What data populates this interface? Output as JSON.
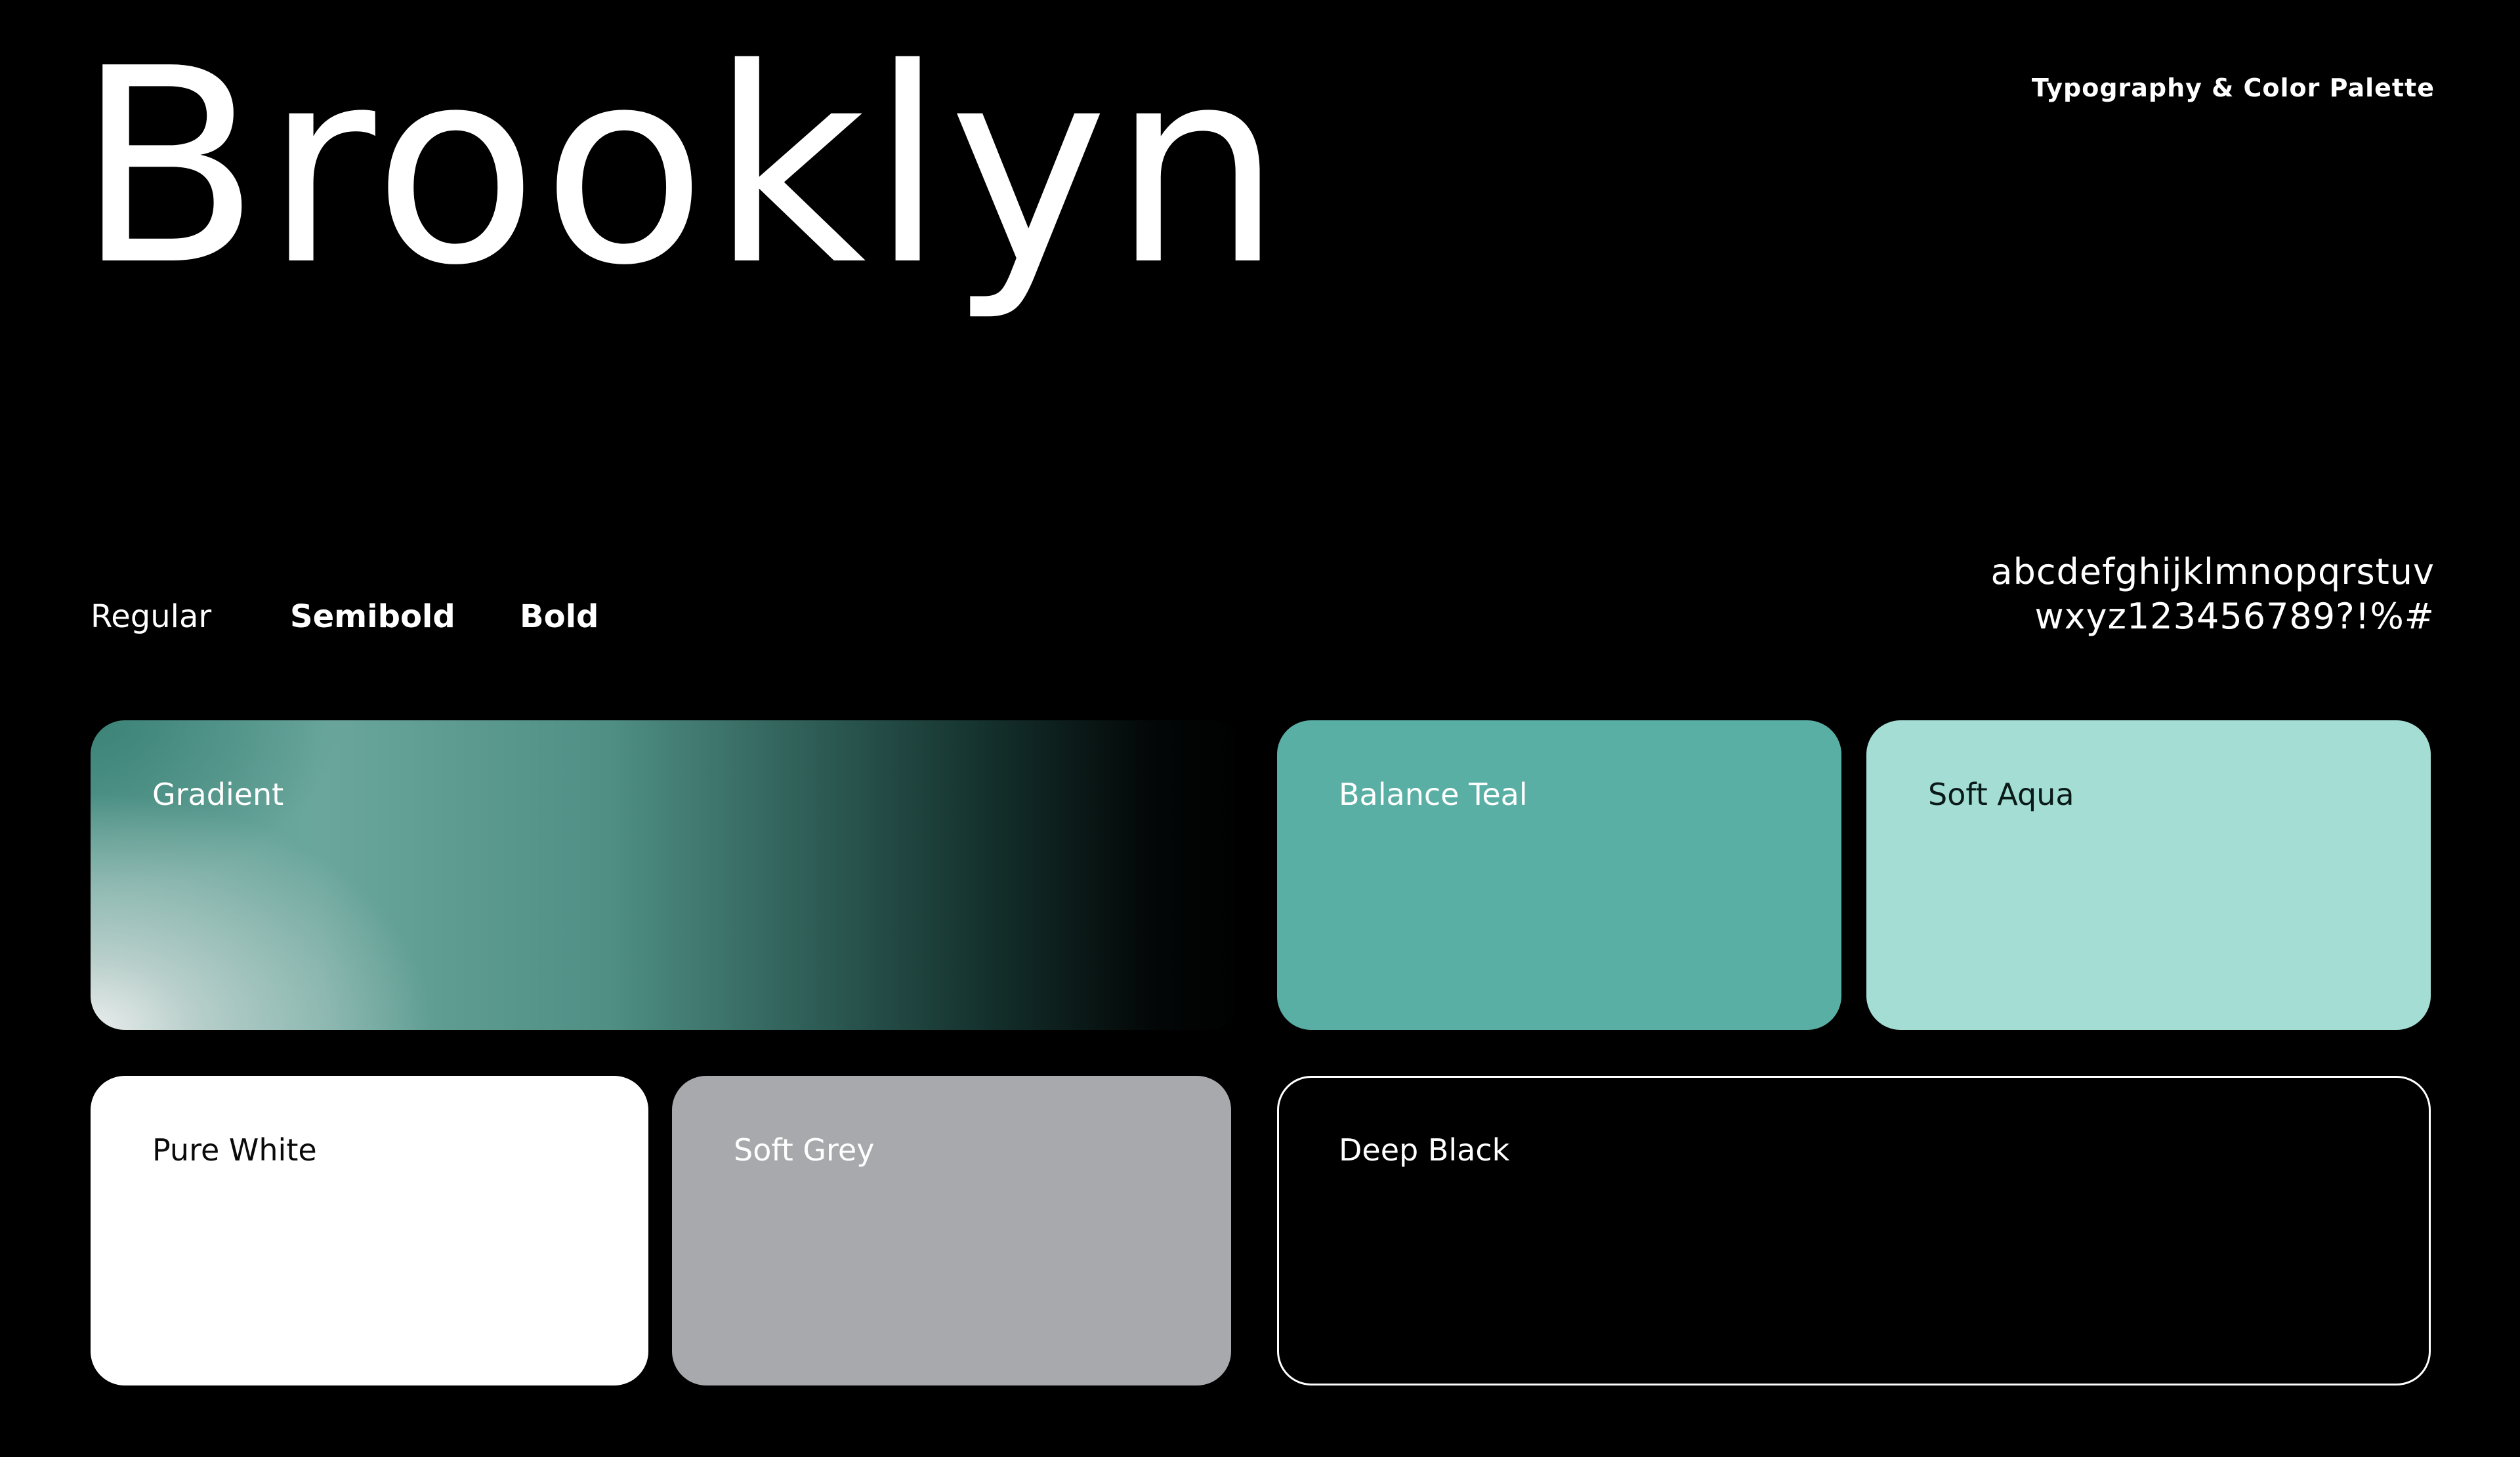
{
  "header": {
    "title": "Brooklyn",
    "subtitle": "Typography & Color Palette"
  },
  "typography": {
    "weights": [
      "Regular",
      "Semibold",
      "Bold"
    ],
    "glyph_line_1": "abcdefghijklmnopqrstuv",
    "glyph_line_2": "wxyz123456789?!%#"
  },
  "palette": {
    "gradient": {
      "label": "Gradient",
      "colors": [
        "#e8ebeb",
        "#5aafa5",
        "#000000"
      ]
    },
    "balance_teal": {
      "label": "Balance Teal",
      "color": "#5aafa5"
    },
    "soft_aqua": {
      "label": "Soft Aqua",
      "color": "#a3ddd4"
    },
    "pure_white": {
      "label": "Pure White",
      "color": "#ffffff"
    },
    "soft_grey": {
      "label": "Soft Grey",
      "color": "#a8a9ac"
    },
    "deep_black": {
      "label": "Deep Black",
      "color": "#000000"
    }
  }
}
